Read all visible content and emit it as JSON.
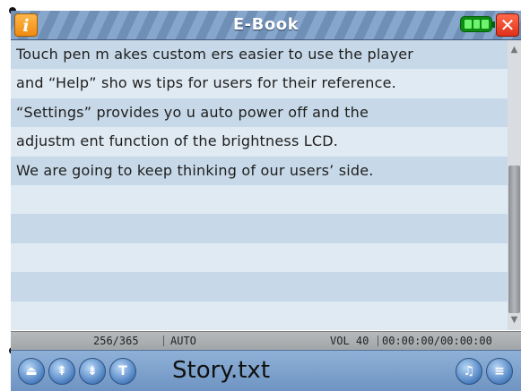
{
  "titlebar": {
    "title": "E-Book",
    "info_icon_glyph": "i",
    "close_icon_glyph": "✕",
    "battery_level": 1.0
  },
  "content": {
    "lines": [
      "Touch pen m akes custom ers easier to use the player",
      "and “Help” sho ws tips for users for their reference.",
      "“Settings” provides yo u auto power off and the",
      "adjustm ent function of the brightness LCD.",
      "We are going to keep thinking of our users’ side.",
      "",
      "",
      "",
      "",
      ""
    ]
  },
  "scrollbar": {
    "up_glyph": "▲",
    "down_glyph": "▼"
  },
  "status": {
    "pages": "256/365",
    "mode": "AUTO",
    "volume": "VOL 40",
    "time": "00:00:00/00:00:00"
  },
  "bottombar": {
    "filename": "Story.txt",
    "buttons": [
      {
        "icon": "eject-icon",
        "glyph": "⏏"
      },
      {
        "icon": "page-up-icon",
        "glyph": "⇞"
      },
      {
        "icon": "page-down-icon",
        "glyph": "⇟"
      },
      {
        "icon": "text-icon",
        "glyph": "T"
      },
      {
        "icon": "music-icon",
        "glyph": "♫"
      },
      {
        "icon": "menu-icon",
        "glyph": "≡"
      }
    ]
  }
}
